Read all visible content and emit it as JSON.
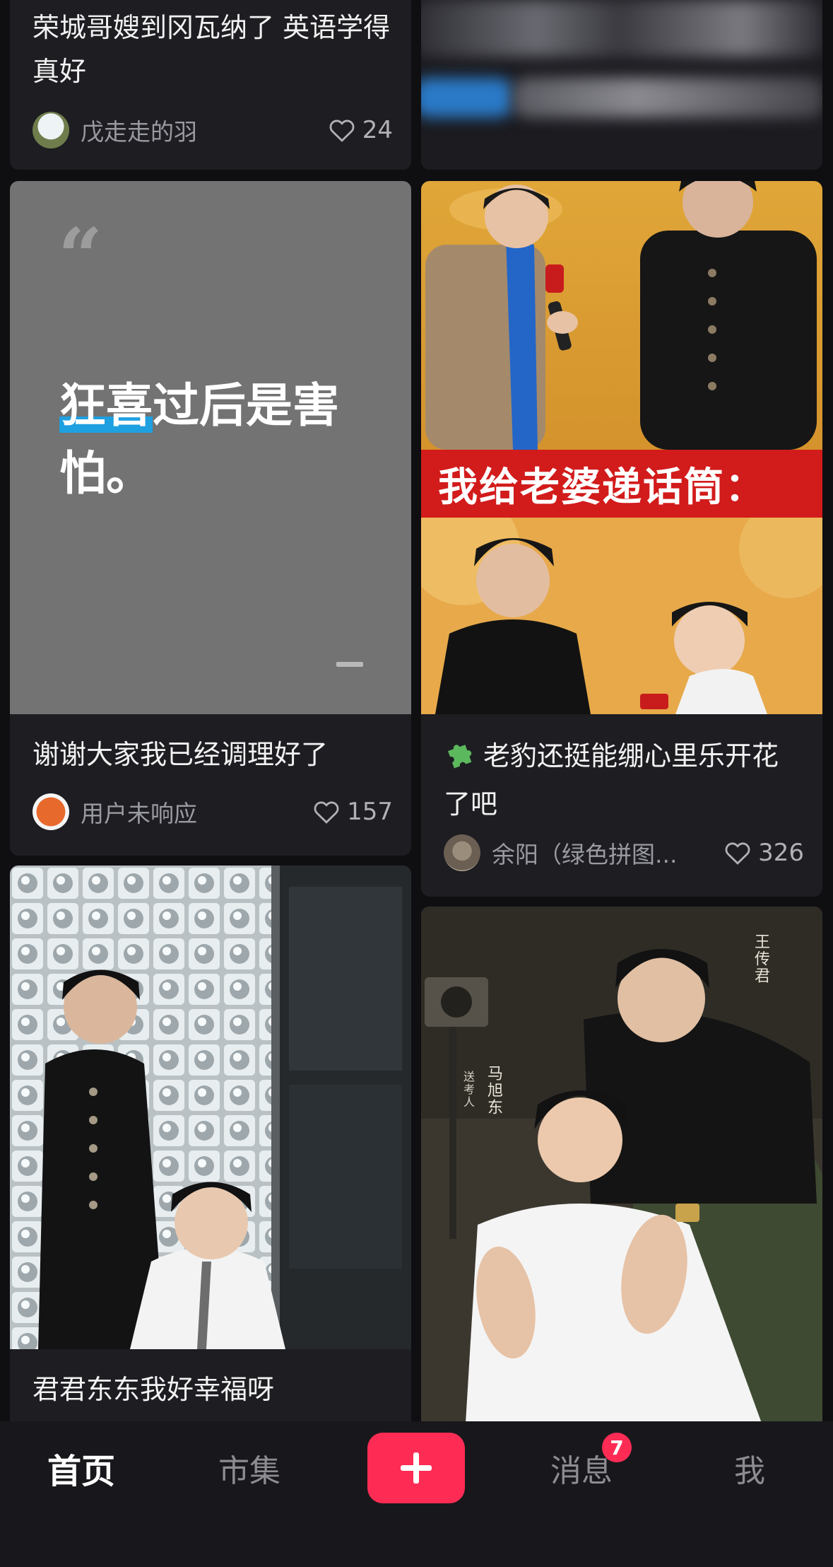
{
  "feed": {
    "cards": [
      {
        "title": "荣城哥嫂到冈瓦纳了 英语学得真好",
        "author": "戊走走的羽",
        "likes": "24"
      },
      {
        "title": "",
        "author": "",
        "likes": ""
      },
      {
        "cover_quote": "狂喜过后是害怕。",
        "cover_quote_highlight": "狂喜",
        "cover_quote_rest": "过后是害怕。",
        "title": "谢谢大家我已经调理好了",
        "author": "用户未响应",
        "likes": "157"
      },
      {
        "cover_banner": "我给老婆递话筒：",
        "title": "老豹还挺能绷心里乐开花了吧",
        "title_emoji": "puzzle-piece-icon",
        "author": "余阳（绿色拼图...",
        "likes": "326"
      },
      {
        "title": "君君东东我好幸福呀",
        "author": "",
        "likes": ""
      },
      {
        "cover_captions": [
          "王传君",
          "马旭东",
          "送考人"
        ],
        "title": "",
        "author": "",
        "likes": ""
      }
    ]
  },
  "tabbar": {
    "home": "首页",
    "market": "市集",
    "add": "+",
    "messages": "消息",
    "messages_badge": "7",
    "me": "我"
  },
  "colors": {
    "accent": "#fe2c55",
    "background": "#0f0f12",
    "card": "#1d1d22"
  }
}
